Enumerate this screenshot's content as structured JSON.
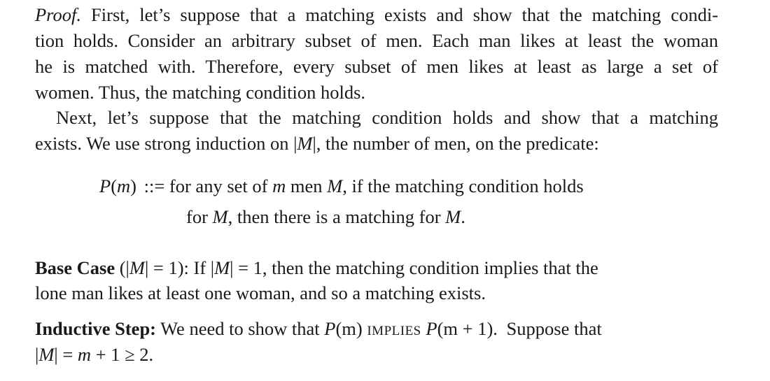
{
  "proof": {
    "label": "Proof.",
    "para1": {
      "l1": "First, let’s suppose that a matching exists and show that the matching condi-",
      "l2": "tion holds. Consider an arbitrary subset of men. Each man likes at least the woman",
      "l3": "he is matched with. Therefore, every subset of men likes at least as large a set of",
      "l4": "women. Thus, the matching condition holds."
    },
    "para2": {
      "l1": "Next, let’s suppose that the matching condition holds and show that a matching",
      "l2_a": "exists. We use strong induction on |",
      "l2_m": "M",
      "l2_b": "|, the number of men, on the predicate:"
    }
  },
  "definition": {
    "lhs_p": "P",
    "lhs_paren_open": "(",
    "lhs_m": "m",
    "lhs_paren_close": ")",
    "defsym": "::=",
    "line1_a": "for any set of",
    "line1_m": "m",
    "line1_b": "men",
    "line1_M": "M",
    "line1_c": ", if the matching condition holds",
    "line2_a": "for",
    "line2_M1": "M",
    "line2_b": ", then there is a matching for",
    "line2_M2": "M",
    "line2_c": "."
  },
  "base_case": {
    "label": "Base Case",
    "cond_open": "(|",
    "cond_M": "M",
    "cond_close": "| = 1):",
    "text_a": "If |",
    "text_M": "M",
    "text_b": "| = 1, then the matching condition implies that the",
    "line2": "lone man likes at least one woman, and so a matching exists."
  },
  "inductive_step": {
    "label": "Inductive Step:",
    "text_a": "We need to show that",
    "p1": "P",
    "p1_arg": "(m)",
    "implies": "implies",
    "p2": "P",
    "p2_arg": "(m + 1).",
    "text_b": "Suppose that",
    "line2_open": "|",
    "line2_M": "M",
    "line2_mid": "| =",
    "line2_m": "m",
    "line2_rest": "+ 1 ≥ 2."
  }
}
